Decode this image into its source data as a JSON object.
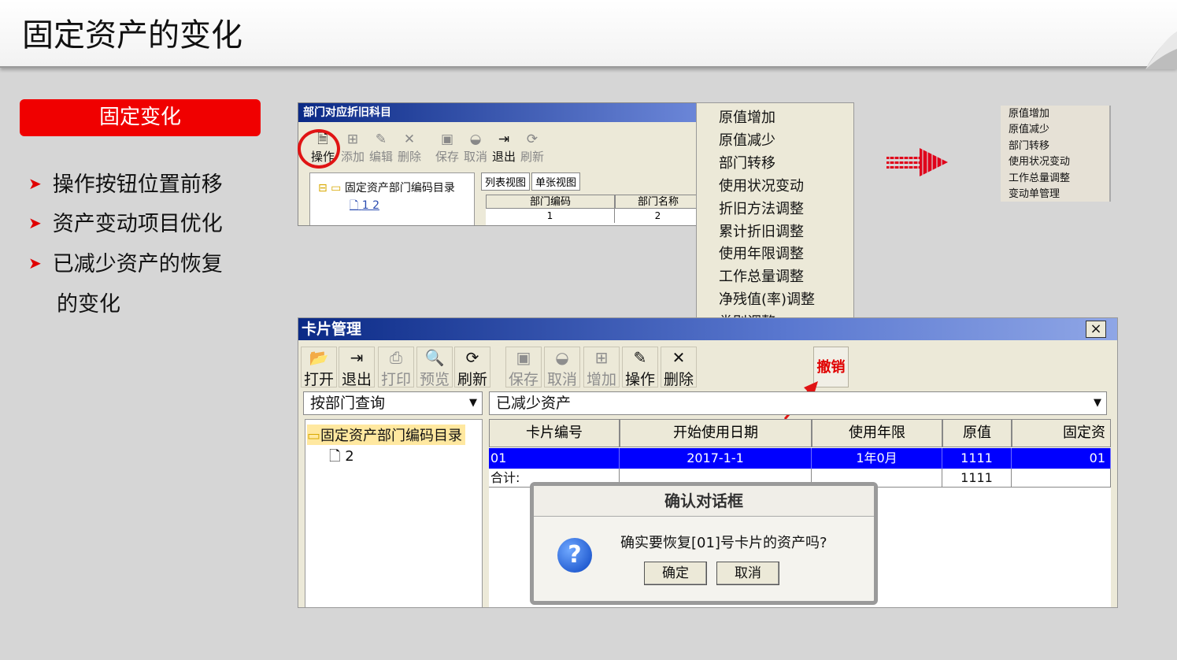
{
  "slide": {
    "title": "固定资产的变化",
    "section_label": "固定变化",
    "bullets": [
      "操作按钮位置前移",
      "资产变动项目优化",
      "已减少资产的恢复",
      "的变化"
    ]
  },
  "window1": {
    "title": "部门对应折旧科目",
    "toolbar": [
      {
        "label": "操作",
        "icon": "document-icon",
        "glyph": "🗎",
        "enabled": true
      },
      {
        "label": "添加",
        "icon": "add-icon",
        "glyph": "⊞",
        "enabled": false
      },
      {
        "label": "编辑",
        "icon": "edit-icon",
        "glyph": "✎",
        "enabled": false
      },
      {
        "label": "删除",
        "icon": "delete-icon",
        "glyph": "✕",
        "enabled": false
      },
      {
        "label": "保存",
        "icon": "save-icon",
        "glyph": "▣",
        "enabled": false
      },
      {
        "label": "取消",
        "icon": "cancel-icon",
        "glyph": "◒",
        "enabled": false
      },
      {
        "label": "退出",
        "icon": "exit-icon",
        "glyph": "⇥",
        "enabled": true
      },
      {
        "label": "刷新",
        "icon": "refresh-icon",
        "glyph": "⟳",
        "enabled": false
      }
    ],
    "tree_root": "固定资产部门编码目录",
    "tree_child": "1 2",
    "tabs": [
      "列表视图",
      "单张视图"
    ],
    "grid_headers": [
      "部门编码",
      "部门名称"
    ],
    "grid_row": [
      "1",
      "2"
    ]
  },
  "context_menu": {
    "items": [
      "原值增加",
      "原值减少",
      "部门转移",
      "使用状况变动",
      "折旧方法调整",
      "累计折旧调整",
      "使用年限调整",
      "工作总量调整",
      "净残值(率)调整",
      "类别调整"
    ]
  },
  "side_menu": {
    "items": [
      "原值增加",
      "原值减少",
      "部门转移",
      "使用状况变动",
      "工作总量调整",
      "变动单管理"
    ]
  },
  "window2": {
    "title": "卡片管理",
    "close_label": "×",
    "toolbar": [
      {
        "label": "打开",
        "icon": "open-folder-icon",
        "glyph": "📂",
        "enabled": true
      },
      {
        "label": "退出",
        "icon": "exit-icon",
        "glyph": "⇥",
        "enabled": true
      },
      {
        "label": "打印",
        "icon": "print-icon",
        "glyph": "⎙",
        "enabled": false
      },
      {
        "label": "预览",
        "icon": "preview-icon",
        "glyph": "🔍",
        "enabled": false
      },
      {
        "label": "刷新",
        "icon": "refresh-icon",
        "glyph": "⟳",
        "enabled": true
      },
      {
        "label": "保存",
        "icon": "save-icon",
        "glyph": "▣",
        "enabled": false
      },
      {
        "label": "取消",
        "icon": "cancel-icon",
        "glyph": "◒",
        "enabled": false
      },
      {
        "label": "增加",
        "icon": "add-icon",
        "glyph": "⊞",
        "enabled": false
      },
      {
        "label": "操作",
        "icon": "operate-icon",
        "glyph": "✎",
        "enabled": true
      },
      {
        "label": "删除",
        "icon": "delete-icon",
        "glyph": "✕",
        "enabled": true
      }
    ],
    "undo_label": "撤销",
    "query_combo": "按部门查询",
    "filter_combo": "已减少资产",
    "dropdown_glyph": "▼",
    "tree_root": "固定资产部门编码目录",
    "tree_child": "2",
    "grid_headers": [
      "卡片编号",
      "开始使用日期",
      "使用年限",
      "原值",
      "固定资"
    ],
    "row": {
      "card_no": "01",
      "start_date": "2017-1-1",
      "years": "1年0月",
      "value": "1111",
      "extra": "01"
    },
    "sum": {
      "label": "合计:",
      "value": "1111"
    }
  },
  "dialog": {
    "title": "确认对话框",
    "message": "确实要恢复[01]号卡片的资产吗?",
    "ok_label": "确定",
    "cancel_label": "取消"
  },
  "colors": {
    "accent_red": "#f00000",
    "selection_blue": "#0000ff",
    "titlebar_blue": "#0b2a86"
  }
}
